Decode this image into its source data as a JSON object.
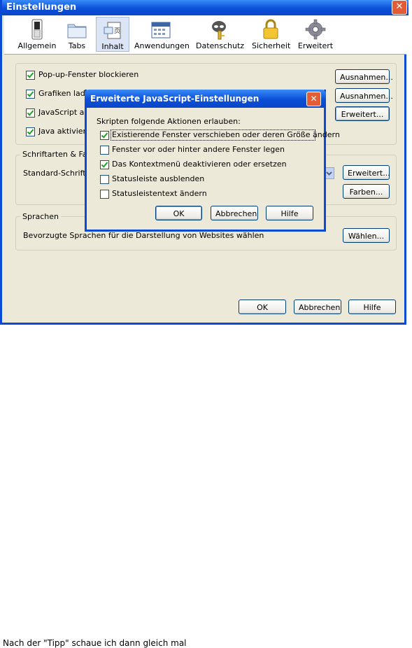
{
  "window": {
    "title": "Einstellungen",
    "close_glyph": "✕"
  },
  "toolbar": {
    "items": [
      {
        "label": "Allgemein",
        "icon": "switch-icon"
      },
      {
        "label": "Tabs",
        "icon": "folder-tabs-icon"
      },
      {
        "label": "Inhalt",
        "icon": "document-icon"
      },
      {
        "label": "Anwendungen",
        "icon": "calendar-icon"
      },
      {
        "label": "Datenschutz",
        "icon": "mask-key-icon"
      },
      {
        "label": "Sicherheit",
        "icon": "padlock-icon"
      },
      {
        "label": "Erweitert",
        "icon": "gear-icon"
      }
    ],
    "active": "Inhalt"
  },
  "content": {
    "popup_label": "Pop-up-Fenster blockieren",
    "popup_checked": true,
    "images_label": "Grafiken laden",
    "images_checked": true,
    "js_label": "JavaScript akti",
    "js_checked": true,
    "java_label": "Java aktivieren",
    "java_checked": true,
    "ausnahmen1": "Ausnahmen...",
    "ausnahmen2": "Ausnahmen...",
    "erweitert_js": "Erweitert...",
    "fonts_group": "Schriftarten & Farb",
    "default_font_label": "Standard-Schriftart",
    "fonts_erweitert": "Erweitert...",
    "farben": "Farben...",
    "lang_group": "Sprachen",
    "lang_desc": "Bevorzugte Sprachen für die Darstellung von Websites wählen",
    "waehlen": "Wählen..."
  },
  "footer": {
    "ok": "OK",
    "cancel": "Abbrechen",
    "help": "Hilfe"
  },
  "dialog": {
    "title": "Erweiterte JavaScript-Einstellungen",
    "intro": "Skripten folgende Aktionen erlauben:",
    "options": [
      {
        "label": "Existierende Fenster verschieben oder deren Größe ändern",
        "checked": true
      },
      {
        "label": "Fenster vor oder hinter andere Fenster legen",
        "checked": false
      },
      {
        "label": "Das Kontextmenü deaktivieren oder ersetzen",
        "checked": true
      },
      {
        "label": "Statusleiste ausblenden",
        "checked": false
      },
      {
        "label": "Statusleistentext ändern",
        "checked": false
      }
    ],
    "ok": "OK",
    "cancel": "Abbrechen",
    "help": "Hilfe",
    "close_glyph": "✕"
  },
  "background": {
    "bottom_text": "Nach der \"Tipp\" schaue ich dann gleich mal"
  }
}
